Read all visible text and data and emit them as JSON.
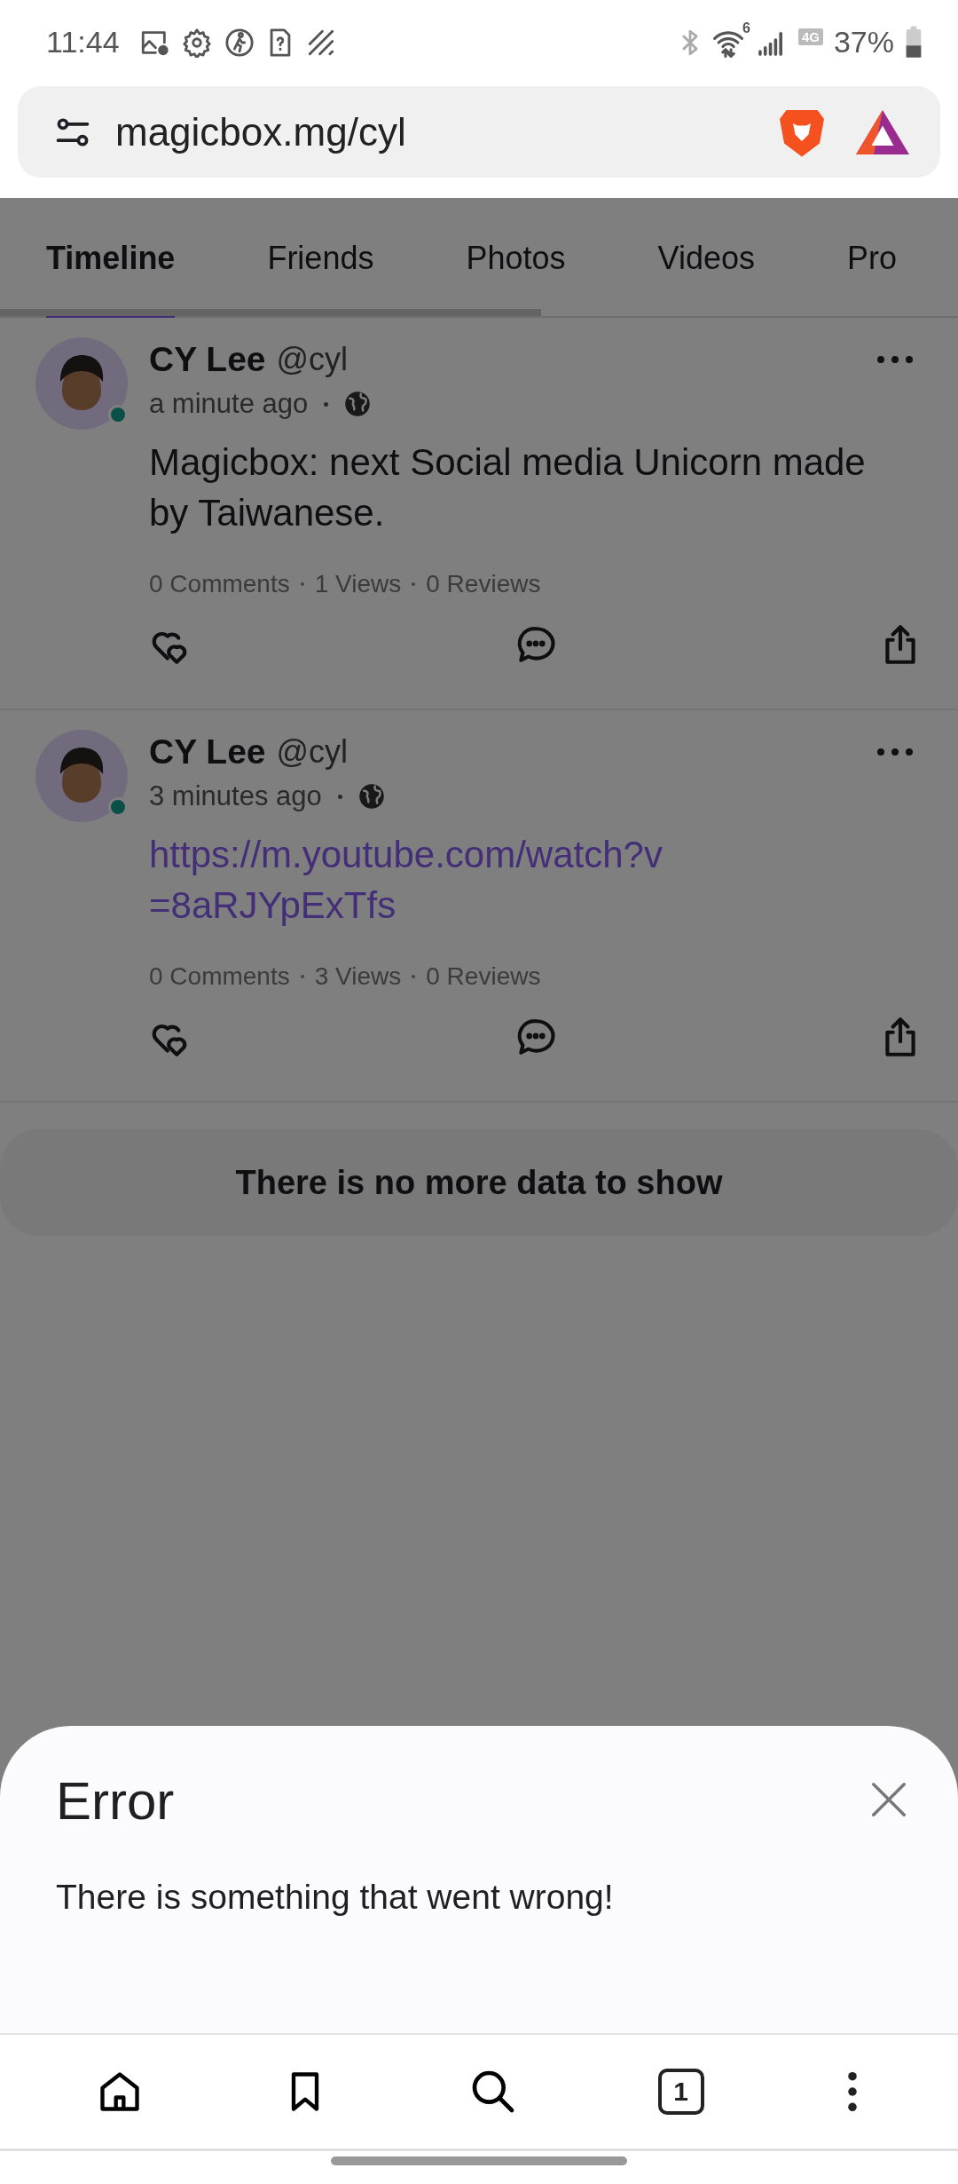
{
  "status_bar": {
    "time": "11:44",
    "wifi_badge": "6",
    "network_label": "4G",
    "battery": "37%"
  },
  "browser": {
    "url": "magicbox.mg/cyl",
    "tab_count": "1"
  },
  "tabs": [
    {
      "label": "Timeline",
      "selected": true
    },
    {
      "label": "Friends",
      "selected": false
    },
    {
      "label": "Photos",
      "selected": false
    },
    {
      "label": "Videos",
      "selected": false
    },
    {
      "label": "Pro",
      "selected": false
    }
  ],
  "posts": [
    {
      "name": "CY Lee",
      "handle": "@cyl",
      "time": "a minute ago",
      "online": true,
      "is_link": false,
      "body": "Magicbox: next Social media Unicorn made by Taiwanese.",
      "stats": [
        "0 Comments",
        "1 Views",
        "0 Reviews"
      ]
    },
    {
      "name": "CY Lee",
      "handle": "@cyl",
      "time": "3 minutes ago",
      "online": true,
      "is_link": true,
      "body": "https://m.youtube.com/watch?v=8aRJYpExTfs",
      "stats": [
        "0 Comments",
        "3 Views",
        "0 Reviews"
      ]
    }
  ],
  "end_note": "There is no more data to show",
  "dialog": {
    "title": "Error",
    "message": "There is something that went wrong!"
  }
}
